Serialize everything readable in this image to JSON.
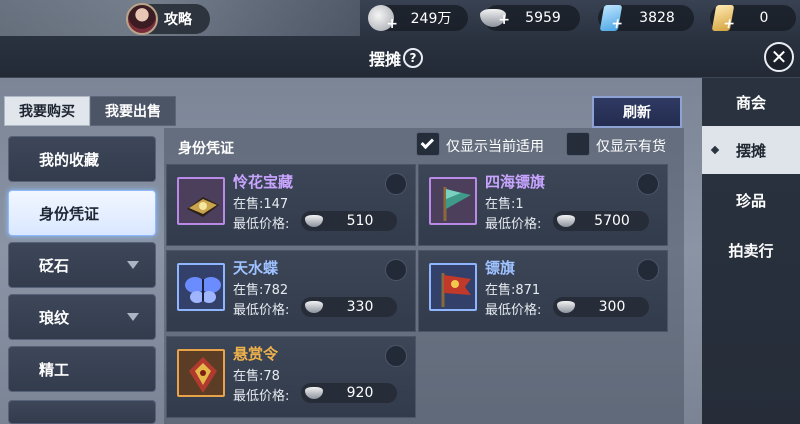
{
  "topbar": {
    "guide_label": "攻略",
    "resources": [
      {
        "icon": "silver-coin-icon",
        "value": "249万"
      },
      {
        "icon": "silver-ingot-icon",
        "value": "5959"
      },
      {
        "icon": "blue-ticket-icon",
        "value": "3828"
      },
      {
        "icon": "gold-ticket-icon",
        "value": "0"
      }
    ]
  },
  "header": {
    "title": "摆摊",
    "help": "?",
    "close": "✕"
  },
  "tabs": [
    {
      "label": "我要购买",
      "active": true
    },
    {
      "label": "我要出售",
      "active": false
    }
  ],
  "refresh_label": "刷新",
  "left_menu": [
    {
      "label": "我的收藏",
      "active": false,
      "dropdown": false
    },
    {
      "label": "身份凭证",
      "active": true,
      "dropdown": false
    },
    {
      "label": "砭石",
      "active": false,
      "dropdown": true
    },
    {
      "label": "琅纹",
      "active": false,
      "dropdown": true
    },
    {
      "label": "精工",
      "active": false,
      "dropdown": false
    }
  ],
  "list": {
    "title": "身份凭证",
    "filter_current": {
      "label": "仅显示当前适用",
      "checked": true
    },
    "filter_stock": {
      "label": "仅显示有货",
      "checked": false
    },
    "stock_prefix": "在售:",
    "price_label": "最低价格:",
    "items": [
      {
        "name": "怜花宝藏",
        "stock": "在售:147",
        "price": "510",
        "icon": "treasure-box-icon"
      },
      {
        "name": "四海镖旗",
        "stock": "在售:1",
        "price": "5700",
        "icon": "escort-flag-icon"
      },
      {
        "name": "天水蝶",
        "stock": "在售:782",
        "price": "330",
        "icon": "butterfly-icon"
      },
      {
        "name": "镖旗",
        "stock": "在售:871",
        "price": "300",
        "icon": "red-flag-icon"
      },
      {
        "name": "悬赏令",
        "stock": "在售:78",
        "price": "920",
        "icon": "bounty-order-icon"
      }
    ]
  },
  "right_nav": [
    {
      "label": "商会",
      "active": false
    },
    {
      "label": "摆摊",
      "active": true
    },
    {
      "label": "珍品",
      "active": false
    },
    {
      "label": "拍卖行",
      "active": false
    }
  ],
  "colors": {
    "rarity_purple": "#c8a4ff",
    "highlight_blue": "#8fc0ff"
  }
}
